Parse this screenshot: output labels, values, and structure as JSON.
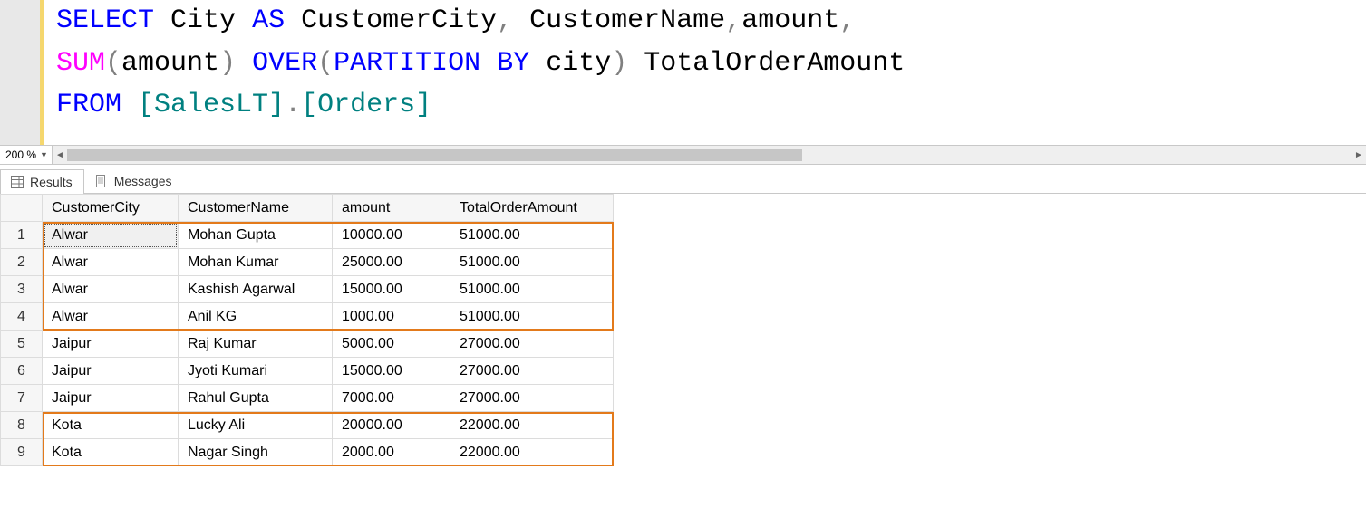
{
  "code": {
    "line1": {
      "t1": "SELECT",
      "t2": " City ",
      "t3": "AS",
      "t4": " CustomerCity",
      "t5": ",",
      "t6": " CustomerName",
      "t7": ",",
      "t8": "amount",
      "t9": ","
    },
    "line2": {
      "t1": "SUM",
      "t2": "(",
      "t3": "amount",
      "t4": ")",
      "t5": " ",
      "t6": "OVER",
      "t7": "(",
      "t8": "PARTITION",
      "t9": " ",
      "t10": "BY",
      "t11": " city",
      "t12": ")",
      "t13": " TotalOrderAmount"
    },
    "line3": {
      "t1": "FROM",
      "t2": " ",
      "t3": "[SalesLT]",
      "t4": ".",
      "t5": "[Orders]"
    }
  },
  "zoom": {
    "level": "200 %"
  },
  "tabs": {
    "results": "Results",
    "messages": "Messages"
  },
  "grid": {
    "headers": {
      "c1": "CustomerCity",
      "c2": "CustomerName",
      "c3": "amount",
      "c4": "TotalOrderAmount"
    },
    "rows": [
      {
        "n": "1",
        "c1": "Alwar",
        "c2": "Mohan Gupta",
        "c3": "10000.00",
        "c4": "51000.00"
      },
      {
        "n": "2",
        "c1": "Alwar",
        "c2": "Mohan Kumar",
        "c3": "25000.00",
        "c4": "51000.00"
      },
      {
        "n": "3",
        "c1": "Alwar",
        "c2": "Kashish Agarwal",
        "c3": "15000.00",
        "c4": "51000.00"
      },
      {
        "n": "4",
        "c1": "Alwar",
        "c2": "Anil KG",
        "c3": "1000.00",
        "c4": "51000.00"
      },
      {
        "n": "5",
        "c1": "Jaipur",
        "c2": "Raj Kumar",
        "c3": "5000.00",
        "c4": "27000.00"
      },
      {
        "n": "6",
        "c1": "Jaipur",
        "c2": "Jyoti Kumari",
        "c3": "15000.00",
        "c4": "27000.00"
      },
      {
        "n": "7",
        "c1": "Jaipur",
        "c2": "Rahul Gupta",
        "c3": "7000.00",
        "c4": "27000.00"
      },
      {
        "n": "8",
        "c1": "Kota",
        "c2": "Lucky Ali",
        "c3": "20000.00",
        "c4": "22000.00"
      },
      {
        "n": "9",
        "c1": "Kota",
        "c2": "Nagar Singh",
        "c3": "2000.00",
        "c4": "22000.00"
      }
    ]
  }
}
